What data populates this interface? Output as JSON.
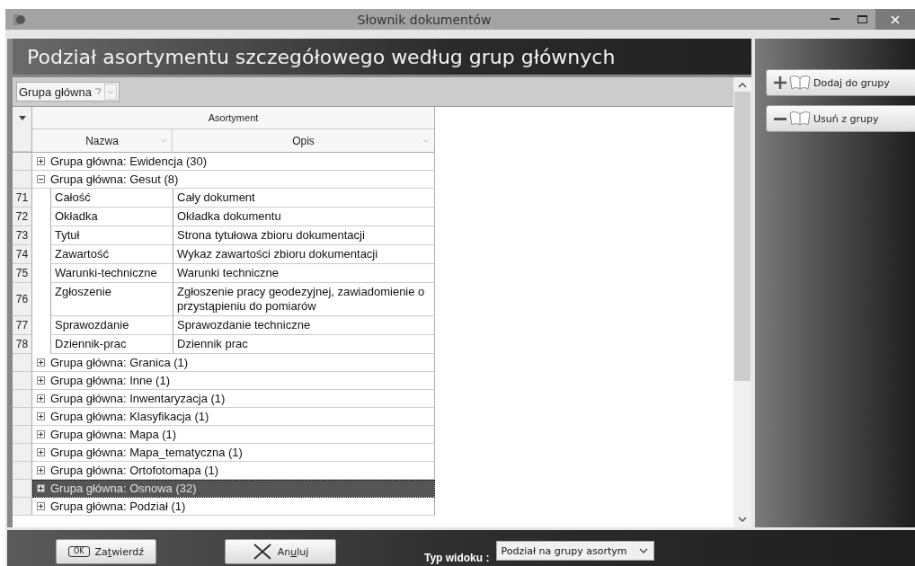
{
  "window": {
    "title": "Słownik dokumentów"
  },
  "heading": "Podział asortymentu szczegółowego według grup głównych",
  "group_by": {
    "label": "Grupa główna"
  },
  "grid": {
    "band": "Asortyment",
    "columns": [
      "Nazwa",
      "Opis"
    ],
    "groups": [
      {
        "label": "Grupa główna: Ewidencja (30)",
        "expanded": false,
        "selected": false
      },
      {
        "label": "Grupa główna: Gesut (8)",
        "expanded": true,
        "selected": false,
        "children": [
          {
            "number": "71",
            "name": "Całość",
            "description": "Cały dokument"
          },
          {
            "number": "72",
            "name": "Okładka",
            "description": "Okładka dokumentu"
          },
          {
            "number": "73",
            "name": "Tytuł",
            "description": "Strona tytułowa zbioru dokumentacji"
          },
          {
            "number": "74",
            "name": "Zawartość",
            "description": "Wykaz zawartości zbioru dokumentacji"
          },
          {
            "number": "75",
            "name": "Warunki-techniczne",
            "description": "Warunki techniczne"
          },
          {
            "number": "76",
            "name": "Zgłoszenie",
            "description": "Zgłoszenie pracy geodezyjnej, zawiadomienie o przystąpieniu do pomiarów"
          },
          {
            "number": "77",
            "name": "Sprawozdanie",
            "description": "Sprawozdanie techniczne"
          },
          {
            "number": "78",
            "name": "Dziennik-prac",
            "description": "Dziennik prac"
          }
        ]
      },
      {
        "label": "Grupa główna: Granica (1)",
        "expanded": false,
        "selected": false
      },
      {
        "label": "Grupa główna: Inne (1)",
        "expanded": false,
        "selected": false
      },
      {
        "label": "Grupa główna: Inwentaryzacja (1)",
        "expanded": false,
        "selected": false
      },
      {
        "label": "Grupa główna: Klasyfikacja (1)",
        "expanded": false,
        "selected": false
      },
      {
        "label": "Grupa główna: Mapa (1)",
        "expanded": false,
        "selected": false
      },
      {
        "label": "Grupa główna: Mapa_tematyczna (1)",
        "expanded": false,
        "selected": false
      },
      {
        "label": "Grupa główna: Ortofotomapa (1)",
        "expanded": false,
        "selected": false
      },
      {
        "label": "Grupa główna: Osnowa (32)",
        "expanded": false,
        "selected": true
      },
      {
        "label": "Grupa główna: Podział (1)",
        "expanded": false,
        "selected": false
      }
    ]
  },
  "side_buttons": [
    {
      "kind": "add",
      "label": "Dodaj do grupy"
    },
    {
      "kind": "remove",
      "label": "Usuń z grupy"
    }
  ],
  "footer": {
    "buttons": [
      {
        "kind": "confirm",
        "icon_text": "OK",
        "label_before": "Za",
        "label_key": "t",
        "label_after": "wierdź"
      },
      {
        "kind": "cancel",
        "label_before": "An",
        "label_key": "u",
        "label_after": "luj"
      }
    ],
    "view_type": {
      "label": "Typ widoku :",
      "value": "Podział na grupy asortym"
    }
  }
}
